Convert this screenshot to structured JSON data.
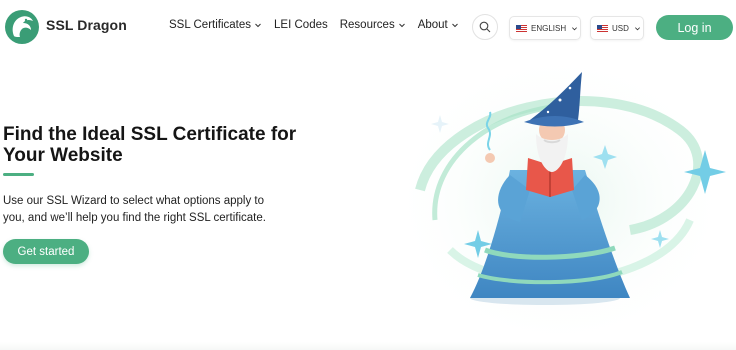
{
  "header": {
    "brand": "SSL Dragon",
    "nav": [
      {
        "label": "SSL Certificates",
        "has_dropdown": true
      },
      {
        "label": "LEI Codes",
        "has_dropdown": false
      },
      {
        "label": "Resources",
        "has_dropdown": true
      },
      {
        "label": "About",
        "has_dropdown": true
      }
    ],
    "language": "ENGLISH",
    "currency": "USD",
    "login_label": "Log in"
  },
  "hero": {
    "title": "Find the Ideal SSL Certificate for Your Website",
    "description": "Use our SSL Wizard to select what options apply to you, and we’ll help you find the right SSL certificate.",
    "cta_label": "Get started"
  },
  "colors": {
    "accent": "#4caf82",
    "wizard_robe": "#4a90c8",
    "book": "#e8574a"
  },
  "icons": {
    "logo": "dragon-logo-icon",
    "search": "search-icon",
    "flag": "us-flag-icon",
    "dropdown": "chevron-down-icon"
  }
}
